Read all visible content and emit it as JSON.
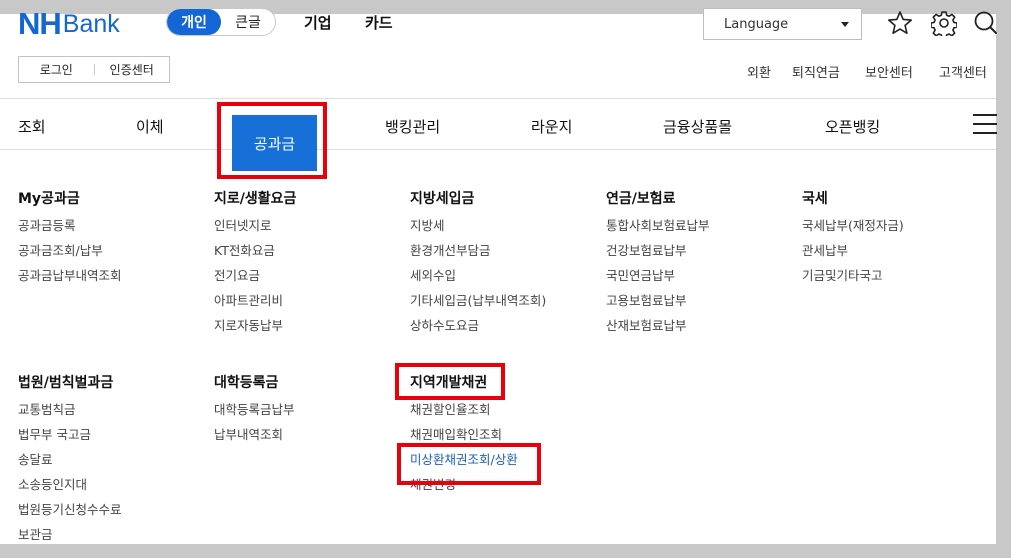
{
  "header": {
    "logo_nh": "NH",
    "logo_bank": "Bank",
    "segments": [
      "개인",
      "큰글"
    ],
    "top_links": [
      "기업",
      "카드"
    ],
    "language_label": "Language"
  },
  "utility": {
    "login": "로그인",
    "cert": "인증센터",
    "links": [
      "외환",
      "퇴직연금",
      "보안센터",
      "고객센터"
    ]
  },
  "nav": {
    "items": [
      "조회",
      "이체",
      "공과금",
      "뱅킹관리",
      "라운지",
      "금융상품몰",
      "오픈뱅킹"
    ],
    "active": "공과금"
  },
  "menu": {
    "row1": [
      {
        "title": "My공과금",
        "items": [
          "공과금등록",
          "공과금조회/납부",
          "공과금납부내역조회"
        ]
      },
      {
        "title": "지로/생활요금",
        "items": [
          "인터넷지로",
          "KT전화요금",
          "전기요금",
          "아파트관리비",
          "지로자동납부"
        ]
      },
      {
        "title": "지방세입금",
        "items": [
          "지방세",
          "환경개선부담금",
          "세외수입",
          "기타세입금(납부내역조회)",
          "상하수도요금"
        ]
      },
      {
        "title": "연금/보험료",
        "items": [
          "통합사회보험료납부",
          "건강보험료납부",
          "국민연금납부",
          "고용보험료납부",
          "산재보험료납부"
        ]
      },
      {
        "title": "국세",
        "items": [
          "국세납부(재정자금)",
          "관세납부",
          "기금및기타국고"
        ]
      }
    ],
    "row2": [
      {
        "title": "법원/범칙벌과금",
        "items": [
          "교통범칙금",
          "법무부 국고금",
          "송달료",
          "소송등인지대",
          "법원등기신청수수료",
          "보관금"
        ]
      },
      {
        "title": "대학등록금",
        "items": [
          "대학등록금납부",
          "납부내역조회"
        ]
      },
      {
        "title": "지역개발채권",
        "items": [
          "채권할인율조회",
          "채권매입확인조회",
          "미상환채권조회/상환",
          "채권변경"
        ]
      }
    ]
  },
  "colors": {
    "brand": "#1366d6",
    "active_nav": "#1670d8",
    "highlight": "#e8000b",
    "link": "#1a5fc0"
  }
}
